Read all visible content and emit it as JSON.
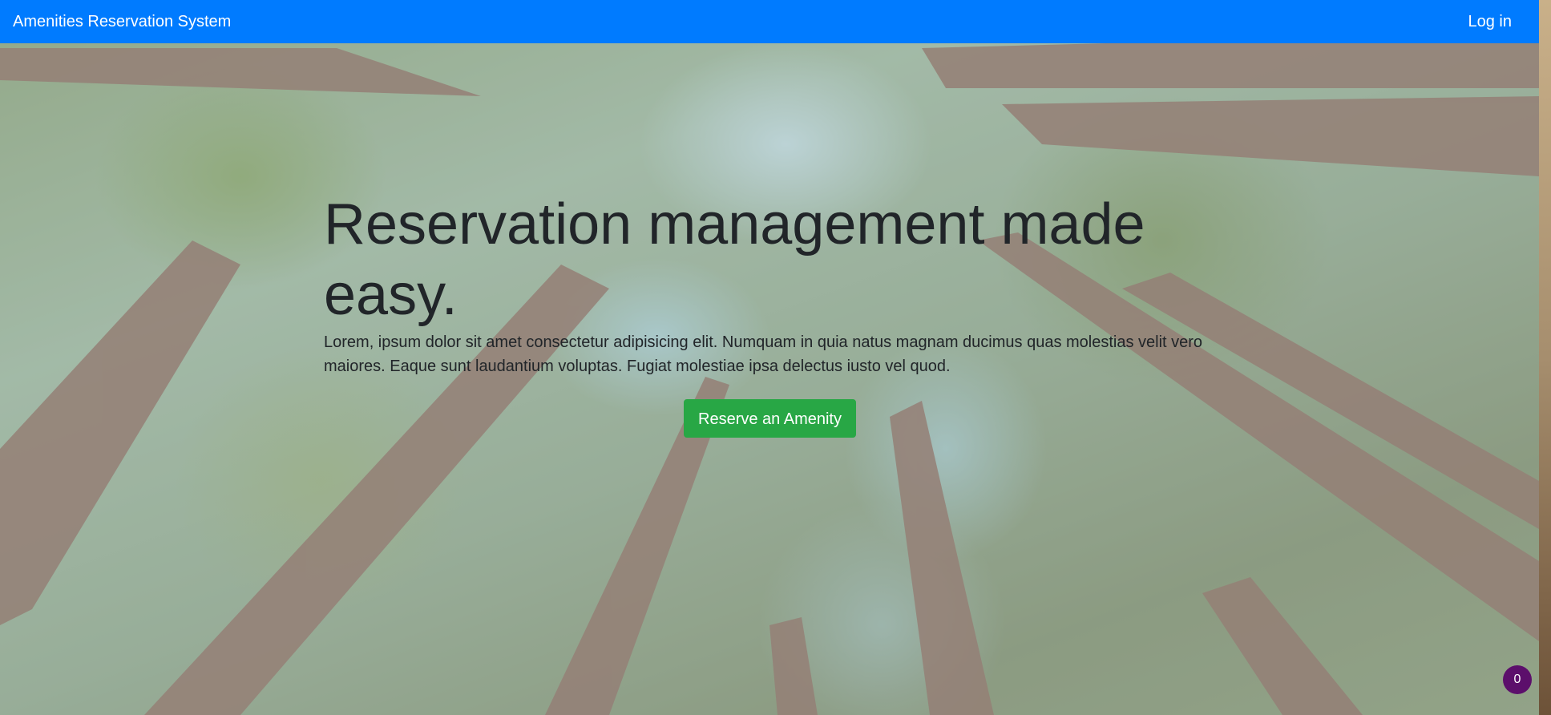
{
  "navbar": {
    "brand": "Amenities Reservation System",
    "login_label": "Log in",
    "color": "#007bff"
  },
  "hero": {
    "title": "Reservation management made easy.",
    "description": "Lorem, ipsum dolor sit amet consectetur adipisicing elit. Numquam in quia natus magnam ducimus quas molestias velit vero maiores. Eaque sunt laudantium voluptas. Fugiat molestiae ipsa delectus iusto vel quod.",
    "cta_label": "Reserve an Amenity",
    "cta_color": "#28a745"
  },
  "floating_badge": {
    "count": "0",
    "color": "#5c0f6b"
  },
  "background": {
    "image": "forest-canopy-photo"
  }
}
